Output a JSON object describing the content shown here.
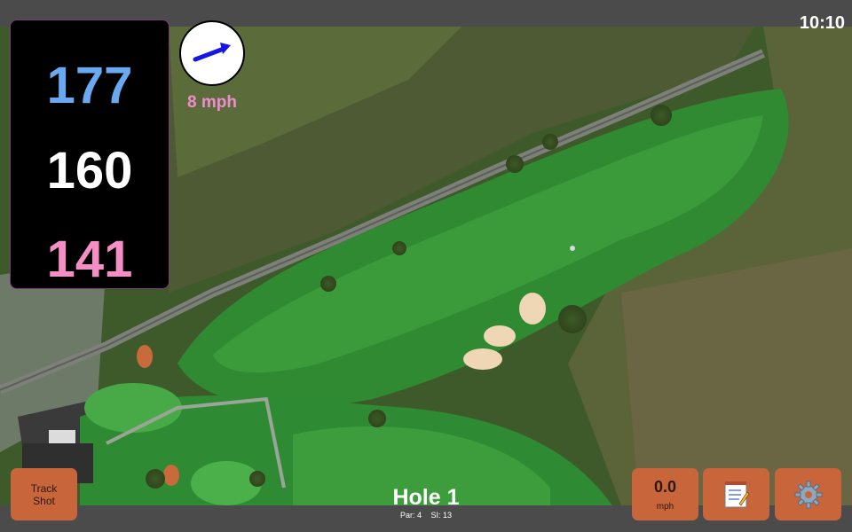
{
  "status": {
    "time": "10:10"
  },
  "distances": {
    "back": "177",
    "middle": "160",
    "front": "141"
  },
  "wind": {
    "speed_label": "8 mph",
    "arrow_icon": "wind-arrow-icon"
  },
  "hole": {
    "title": "Hole 1",
    "par": "Par: 4",
    "si": "SI: 13"
  },
  "buttons": {
    "track_line1": "Track",
    "track_line2": "Shot",
    "wind_value": "0.0",
    "wind_unit": "mph",
    "notes_icon": "notepad-icon",
    "settings_icon": "gear-icon"
  },
  "colors": {
    "back": "#6aa9f0",
    "middle": "#ffffff",
    "front": "#f38fc4",
    "button": "#c8653b",
    "bar": "#4b4b4b"
  }
}
